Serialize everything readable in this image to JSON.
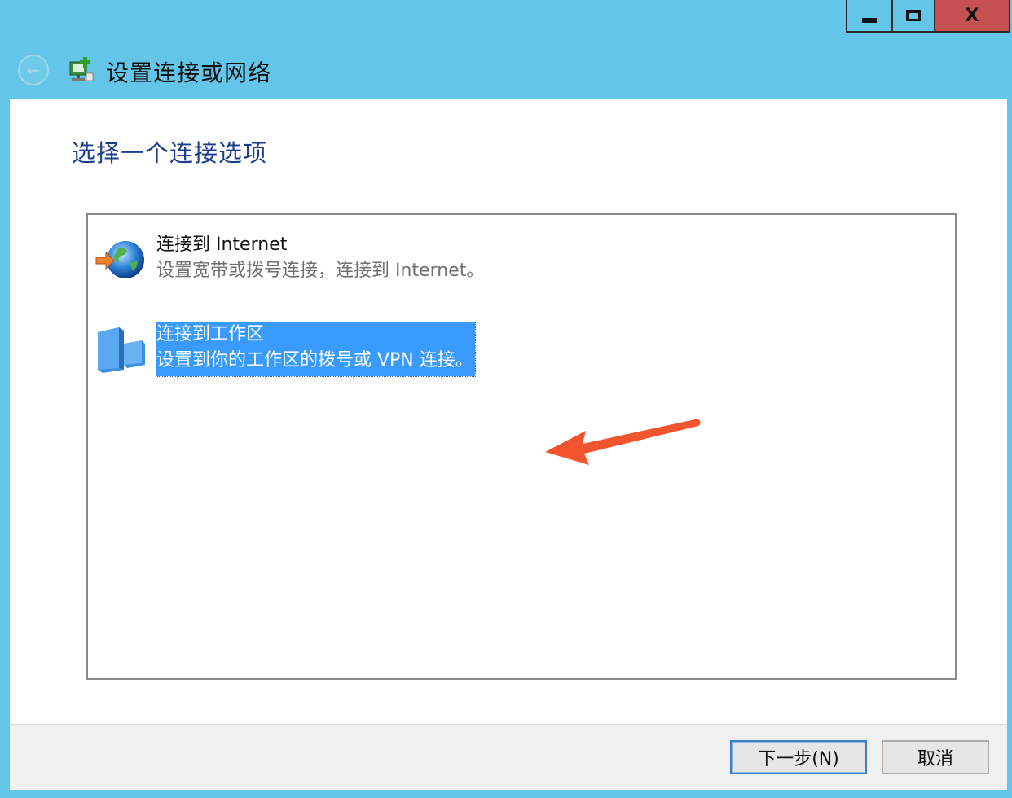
{
  "window": {
    "title": "设置连接或网络",
    "controls": {
      "minimize_icon": "minimize-icon",
      "maximize_icon": "maximize-icon",
      "close_label": "X"
    }
  },
  "page": {
    "heading": "选择一个连接选项"
  },
  "options": [
    {
      "title": "连接到 Internet",
      "description": "设置宽带或拨号连接，连接到 Internet。",
      "icon": "globe-connect-icon",
      "selected": false
    },
    {
      "title": "连接到工作区",
      "description": "设置到你的工作区的拨号或 VPN 连接。",
      "icon": "workplace-icon",
      "selected": true
    }
  ],
  "buttons": {
    "next": "下一步(N)",
    "cancel": "取消"
  },
  "colors": {
    "title_bar": "#63c6e9",
    "heading": "#1a3e8c",
    "selection": "#3a9bff",
    "annotation_arrow": "#f2542d",
    "close_button": "#c75050"
  }
}
